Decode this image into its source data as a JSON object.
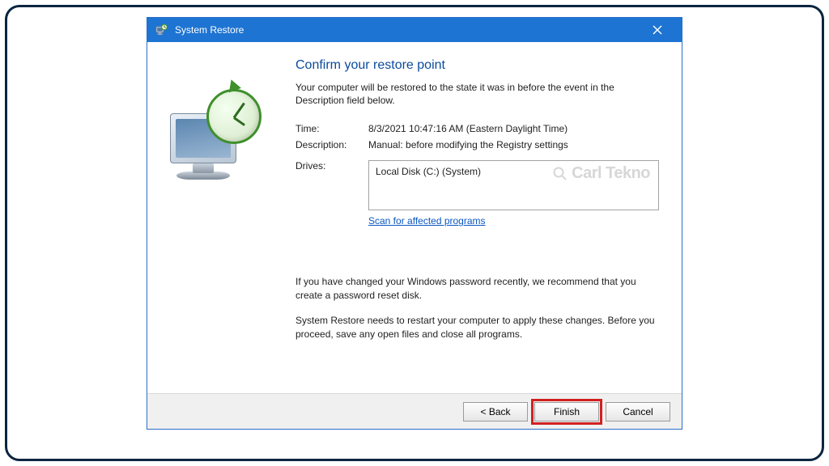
{
  "window": {
    "title": "System Restore"
  },
  "main": {
    "heading": "Confirm your restore point",
    "subtext": "Your computer will be restored to the state it was in before the event in the Description field below."
  },
  "fields": {
    "time_label": "Time:",
    "time_value": "8/3/2021 10:47:16 AM (Eastern Daylight Time)",
    "description_label": "Description:",
    "description_value": "Manual: before modifying the Registry settings",
    "drives_label": "Drives:",
    "drives_value": "Local Disk (C:) (System)"
  },
  "links": {
    "scan": "Scan for affected programs"
  },
  "notes": {
    "password_tip": "If you have changed your Windows password recently, we recommend that you create a password reset disk.",
    "restart_tip": "System Restore needs to restart your computer to apply these changes. Before you proceed, save any open files and close all programs."
  },
  "buttons": {
    "back": "< Back",
    "finish": "Finish",
    "cancel": "Cancel"
  },
  "watermark": {
    "brand": "Carl Tekno"
  }
}
